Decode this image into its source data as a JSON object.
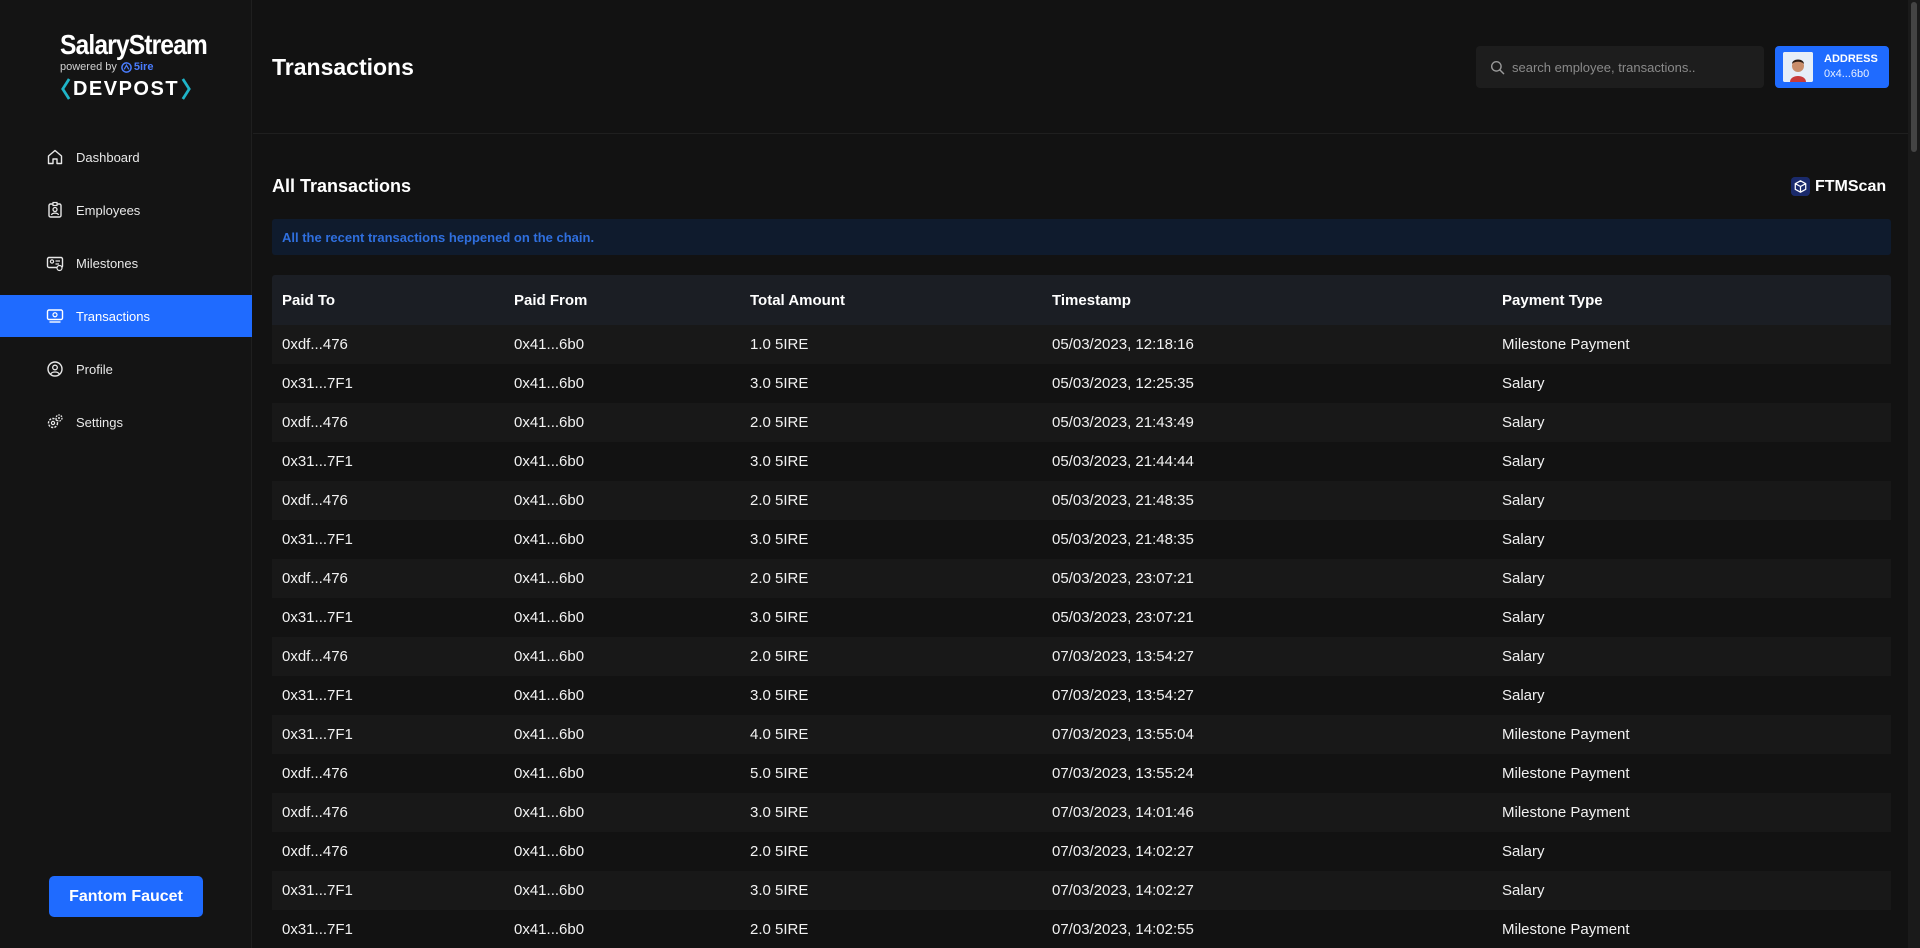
{
  "brand": {
    "title": "SalaryStream",
    "powered_by": "powered by",
    "chain": "5ire",
    "hackathon": "DEVPOST"
  },
  "sidebar": {
    "items": [
      {
        "label": "Dashboard",
        "icon": "home-icon",
        "active": false
      },
      {
        "label": "Employees",
        "icon": "employee-badge-icon",
        "active": false
      },
      {
        "label": "Milestones",
        "icon": "milestone-card-icon",
        "active": false
      },
      {
        "label": "Transactions",
        "icon": "transactions-icon",
        "active": true
      },
      {
        "label": "Profile",
        "icon": "profile-icon",
        "active": false
      },
      {
        "label": "Settings",
        "icon": "gear-icon",
        "active": false
      }
    ],
    "faucet_label": "Fantom Faucet"
  },
  "header": {
    "title": "Transactions",
    "search_placeholder": "search employee, transactions..",
    "address_label": "ADDRESS",
    "address_value": "0x4...6b0"
  },
  "main": {
    "section_title": "All Transactions",
    "explorer_label": "FTMScan",
    "banner_text": "All the recent transactions heppened on the chain.",
    "columns": [
      "Paid To",
      "Paid From",
      "Total Amount",
      "Timestamp",
      "Payment Type"
    ],
    "rows": [
      [
        "0xdf...476",
        "0x41...6b0",
        "1.0 5IRE",
        "05/03/2023, 12:18:16",
        "Milestone Payment"
      ],
      [
        "0x31...7F1",
        "0x41...6b0",
        "3.0 5IRE",
        "05/03/2023, 12:25:35",
        "Salary"
      ],
      [
        "0xdf...476",
        "0x41...6b0",
        "2.0 5IRE",
        "05/03/2023, 21:43:49",
        "Salary"
      ],
      [
        "0x31...7F1",
        "0x41...6b0",
        "3.0 5IRE",
        "05/03/2023, 21:44:44",
        "Salary"
      ],
      [
        "0xdf...476",
        "0x41...6b0",
        "2.0 5IRE",
        "05/03/2023, 21:48:35",
        "Salary"
      ],
      [
        "0x31...7F1",
        "0x41...6b0",
        "3.0 5IRE",
        "05/03/2023, 21:48:35",
        "Salary"
      ],
      [
        "0xdf...476",
        "0x41...6b0",
        "2.0 5IRE",
        "05/03/2023, 23:07:21",
        "Salary"
      ],
      [
        "0x31...7F1",
        "0x41...6b0",
        "3.0 5IRE",
        "05/03/2023, 23:07:21",
        "Salary"
      ],
      [
        "0xdf...476",
        "0x41...6b0",
        "2.0 5IRE",
        "07/03/2023, 13:54:27",
        "Salary"
      ],
      [
        "0x31...7F1",
        "0x41...6b0",
        "3.0 5IRE",
        "07/03/2023, 13:54:27",
        "Salary"
      ],
      [
        "0x31...7F1",
        "0x41...6b0",
        "4.0 5IRE",
        "07/03/2023, 13:55:04",
        "Milestone Payment"
      ],
      [
        "0xdf...476",
        "0x41...6b0",
        "5.0 5IRE",
        "07/03/2023, 13:55:24",
        "Milestone Payment"
      ],
      [
        "0xdf...476",
        "0x41...6b0",
        "3.0 5IRE",
        "07/03/2023, 14:01:46",
        "Milestone Payment"
      ],
      [
        "0xdf...476",
        "0x41...6b0",
        "2.0 5IRE",
        "07/03/2023, 14:02:27",
        "Salary"
      ],
      [
        "0x31...7F1",
        "0x41...6b0",
        "3.0 5IRE",
        "07/03/2023, 14:02:27",
        "Salary"
      ],
      [
        "0x31...7F1",
        "0x41...6b0",
        "2.0 5IRE",
        "07/03/2023, 14:02:55",
        "Milestone Payment"
      ]
    ]
  },
  "colors": {
    "accent": "#1f6bff",
    "background": "#121212",
    "banner_text": "#2f6fde"
  }
}
